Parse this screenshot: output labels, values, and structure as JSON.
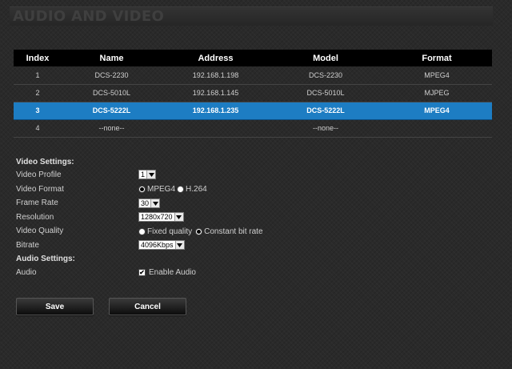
{
  "page": {
    "title": "AUDIO AND VIDEO"
  },
  "table": {
    "headers": [
      "Index",
      "Name",
      "Address",
      "Model",
      "Format"
    ],
    "rows": [
      {
        "index": "1",
        "name": "DCS-2230",
        "address": "192.168.1.198",
        "model": "DCS-2230",
        "format": "MPEG4"
      },
      {
        "index": "2",
        "name": "DCS-5010L",
        "address": "192.168.1.145",
        "model": "DCS-5010L",
        "format": "MJPEG"
      },
      {
        "index": "3",
        "name": "DCS-5222L",
        "address": "192.168.1.235",
        "model": "DCS-5222L",
        "format": "MPEG4"
      },
      {
        "index": "4",
        "name": "--none--",
        "address": "",
        "model": "--none--",
        "format": ""
      }
    ],
    "selected_index": "3"
  },
  "video_settings": {
    "heading": "Video Settings:",
    "profile": {
      "label": "Video Profile",
      "value": "1"
    },
    "format": {
      "label": "Video Format",
      "options": [
        "MPEG4",
        "H.264"
      ],
      "selected": "MPEG4"
    },
    "frame_rate": {
      "label": "Frame Rate",
      "value": "30"
    },
    "resolution": {
      "label": "Resolution",
      "value": "1280x720"
    },
    "quality": {
      "label": "Video Quality",
      "options": [
        "Fixed quality",
        "Constant bit rate"
      ],
      "selected": "Constant bit rate"
    },
    "bitrate": {
      "label": "Bitrate",
      "value": "4096Kbps"
    }
  },
  "audio_settings": {
    "heading": "Audio Settings:",
    "audio": {
      "label": "Audio",
      "checkbox_label": "Enable Audio",
      "checked": true
    }
  },
  "buttons": {
    "save": "Save",
    "cancel": "Cancel"
  },
  "colors": {
    "selected_row": "#1d7dc3",
    "header_bg": "#000000",
    "background": "#2a2a2a"
  }
}
